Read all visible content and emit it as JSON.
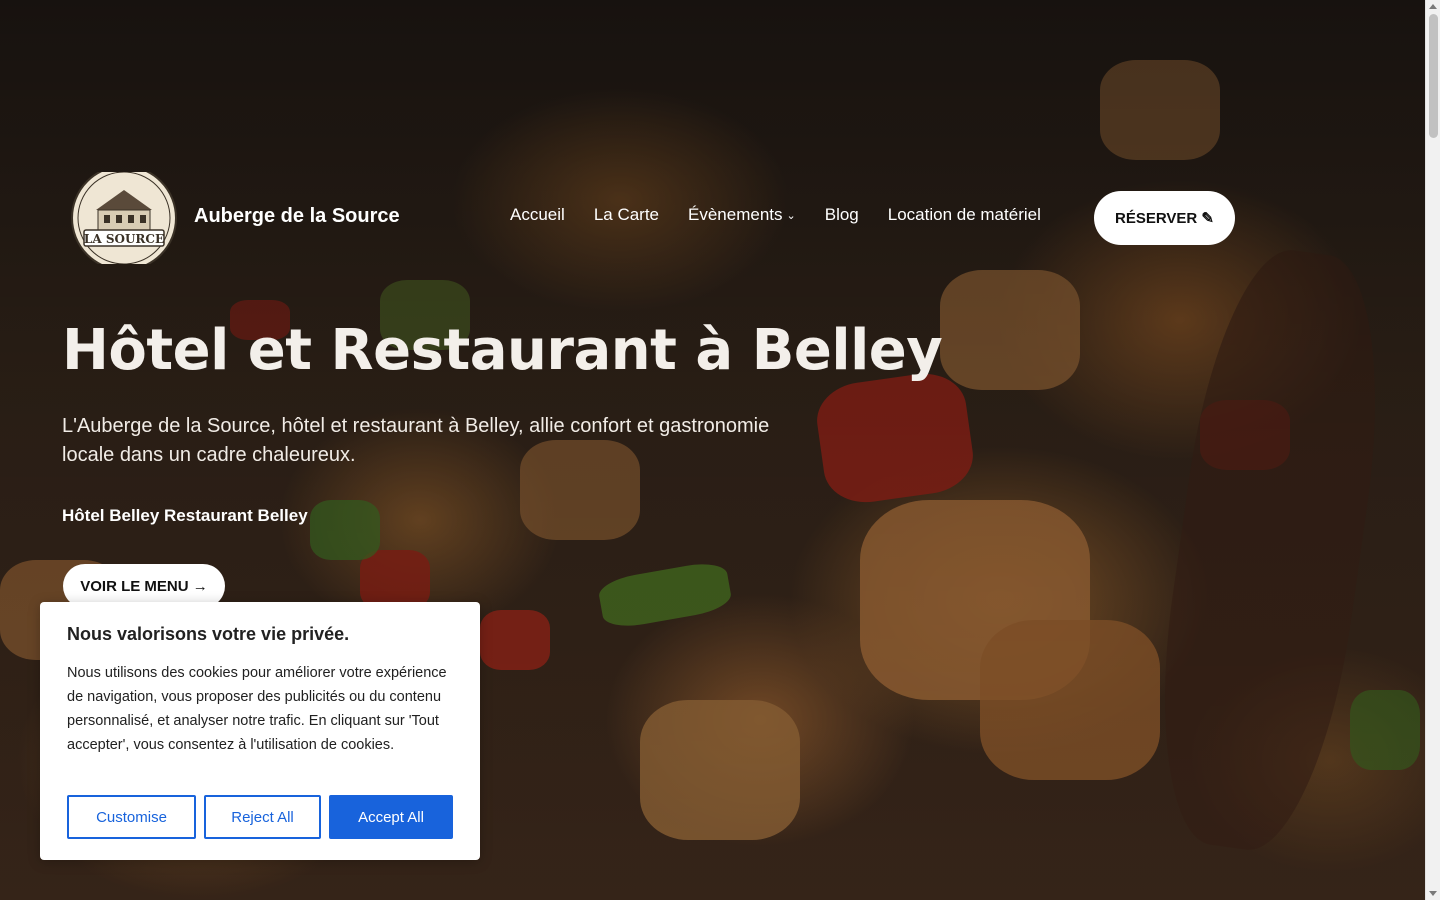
{
  "header": {
    "brand": "Auberge de la Source",
    "logo_text": "LA SOURCE",
    "nav": [
      "Accueil",
      "La Carte",
      "Évènements",
      "Blog",
      "Location de matériel"
    ],
    "reserve_label": "RÉSERVER ✎"
  },
  "hero": {
    "title": "Hôtel et Restaurant à Belley",
    "description": "L'Auberge de la Source, hôtel et restaurant à Belley, allie confort et gastronomie locale dans un cadre chaleureux.",
    "tags": "Hôtel Belley Restaurant Belley",
    "menu_button": "VOIR LE MENU →"
  },
  "cookie": {
    "title": "Nous valorisons votre vie privée.",
    "text": "Nous utilisons des cookies pour améliorer votre expérience de navigation, vous proposer des publicités ou du contenu personnalisé, et analyser notre trafic. En cliquant sur 'Tout accepter', vous consentez à l'utilisation de cookies.",
    "customise": "Customise",
    "reject": "Reject All",
    "accept": "Accept All"
  },
  "colors": {
    "accent_blue": "#1863dc",
    "button_white": "#ffffff"
  },
  "icons": {
    "dropdown": "chevron-down-icon",
    "reserve": "pencil-icon",
    "menu_arrow": "arrow-right-icon"
  }
}
